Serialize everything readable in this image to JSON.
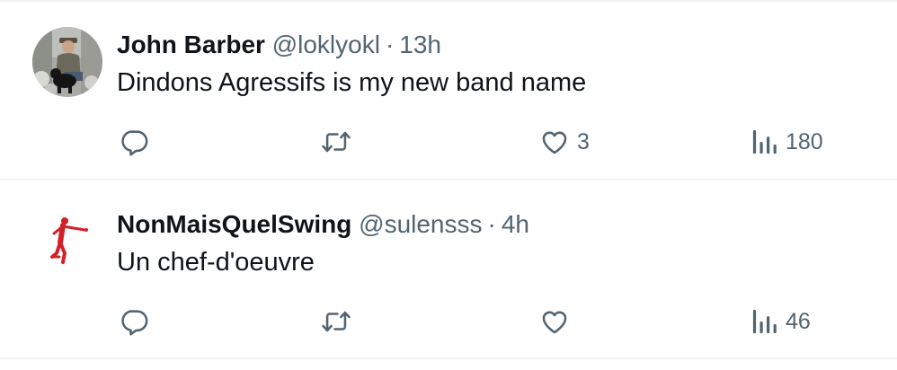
{
  "tweets": [
    {
      "display_name": "John Barber",
      "handle": "@loklyokl",
      "separator": "·",
      "timestamp": "13h",
      "text": "Dindons Agressifs is my new band name",
      "avatar_icon": "user-photo-avatar",
      "actions": {
        "reply": {
          "icon": "reply-icon",
          "count": ""
        },
        "retweet": {
          "icon": "retweet-icon",
          "count": ""
        },
        "like": {
          "icon": "heart-icon",
          "count": "3"
        },
        "views": {
          "icon": "views-icon",
          "count": "180"
        }
      }
    },
    {
      "display_name": "NonMaisQuelSwing",
      "handle": "@sulensss",
      "separator": "·",
      "timestamp": "4h",
      "text": "Un chef-d'oeuvre",
      "avatar_icon": "golfer-logo-avatar",
      "actions": {
        "reply": {
          "icon": "reply-icon",
          "count": ""
        },
        "retweet": {
          "icon": "retweet-icon",
          "count": ""
        },
        "like": {
          "icon": "heart-icon",
          "count": ""
        },
        "views": {
          "icon": "views-icon",
          "count": "46"
        }
      }
    }
  ],
  "colors": {
    "text_primary": "#0f1419",
    "text_secondary": "#536471",
    "divider": "#eff3f4",
    "golfer_red": "#d32027"
  }
}
